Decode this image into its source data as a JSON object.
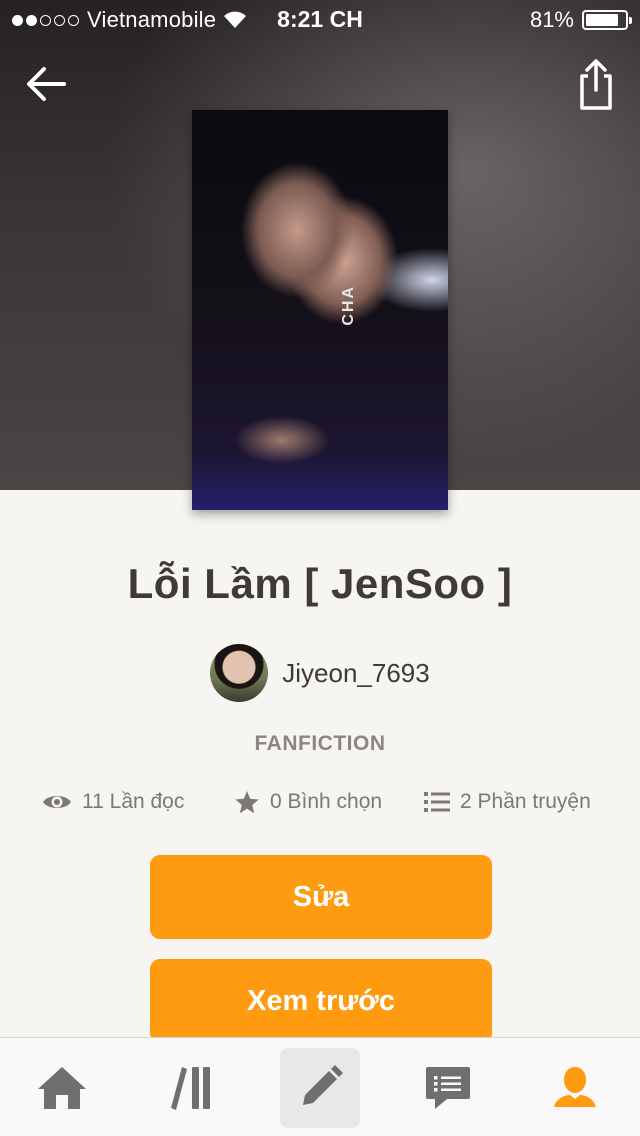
{
  "status_bar": {
    "carrier": "Vietnamobile",
    "time": "8:21 CH",
    "battery": "81%",
    "battery_level": 0.81,
    "signal_bars": 2
  },
  "header": {
    "back_icon": "arrow-left-icon",
    "share_icon": "share-icon",
    "cover_text": "CHA"
  },
  "story": {
    "title": "Lỗi Lầm [ JenSoo ]",
    "author": "Jiyeon_7693",
    "category": "FANFICTION",
    "stats": {
      "reads": "11 Lần đọc",
      "votes": "0 Bình chọn",
      "parts": "2 Phần truyện"
    }
  },
  "actions": {
    "edit_label": "Sửa",
    "preview_label": "Xem trước"
  },
  "tabbar": {
    "items": [
      "home-icon",
      "library-icon",
      "write-icon",
      "messages-icon",
      "profile-icon"
    ],
    "active": "profile-icon"
  },
  "colors": {
    "accent": "#ff9b10",
    "background": "#f6f5f1",
    "text": "#3e3a38",
    "muted": "#7c7874",
    "tab_inactive": "#6f6f6f"
  }
}
